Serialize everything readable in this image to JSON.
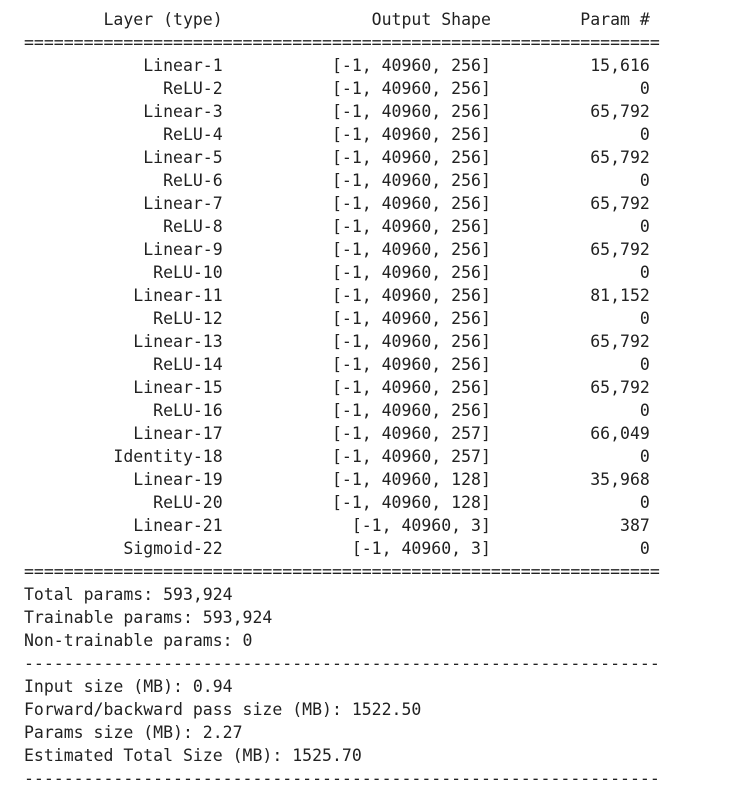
{
  "separator_double": "================================================================",
  "separator_single": "----------------------------------------------------------------",
  "header": {
    "layer": "Layer (type)",
    "output_shape": "Output Shape",
    "params": "Param #"
  },
  "layers": [
    {
      "name": "Linear-1",
      "shape": "[-1, 40960, 256]",
      "params": "15,616"
    },
    {
      "name": "ReLU-2",
      "shape": "[-1, 40960, 256]",
      "params": "0"
    },
    {
      "name": "Linear-3",
      "shape": "[-1, 40960, 256]",
      "params": "65,792"
    },
    {
      "name": "ReLU-4",
      "shape": "[-1, 40960, 256]",
      "params": "0"
    },
    {
      "name": "Linear-5",
      "shape": "[-1, 40960, 256]",
      "params": "65,792"
    },
    {
      "name": "ReLU-6",
      "shape": "[-1, 40960, 256]",
      "params": "0"
    },
    {
      "name": "Linear-7",
      "shape": "[-1, 40960, 256]",
      "params": "65,792"
    },
    {
      "name": "ReLU-8",
      "shape": "[-1, 40960, 256]",
      "params": "0"
    },
    {
      "name": "Linear-9",
      "shape": "[-1, 40960, 256]",
      "params": "65,792"
    },
    {
      "name": "ReLU-10",
      "shape": "[-1, 40960, 256]",
      "params": "0"
    },
    {
      "name": "Linear-11",
      "shape": "[-1, 40960, 256]",
      "params": "81,152"
    },
    {
      "name": "ReLU-12",
      "shape": "[-1, 40960, 256]",
      "params": "0"
    },
    {
      "name": "Linear-13",
      "shape": "[-1, 40960, 256]",
      "params": "65,792"
    },
    {
      "name": "ReLU-14",
      "shape": "[-1, 40960, 256]",
      "params": "0"
    },
    {
      "name": "Linear-15",
      "shape": "[-1, 40960, 256]",
      "params": "65,792"
    },
    {
      "name": "ReLU-16",
      "shape": "[-1, 40960, 256]",
      "params": "0"
    },
    {
      "name": "Linear-17",
      "shape": "[-1, 40960, 257]",
      "params": "66,049"
    },
    {
      "name": "Identity-18",
      "shape": "[-1, 40960, 257]",
      "params": "0"
    },
    {
      "name": "Linear-19",
      "shape": "[-1, 40960, 128]",
      "params": "35,968"
    },
    {
      "name": "ReLU-20",
      "shape": "[-1, 40960, 128]",
      "params": "0"
    },
    {
      "name": "Linear-21",
      "shape": "[-1, 40960, 3]",
      "params": "387"
    },
    {
      "name": "Sigmoid-22",
      "shape": "[-1, 40960, 3]",
      "params": "0"
    }
  ],
  "param_totals": [
    "Total params: 593,924",
    "Trainable params: 593,924",
    "Non-trainable params: 0"
  ],
  "size_totals": [
    "Input size (MB): 0.94",
    "Forward/backward pass size (MB): 1522.50",
    "Params size (MB): 2.27",
    "Estimated Total Size (MB): 1525.70"
  ]
}
